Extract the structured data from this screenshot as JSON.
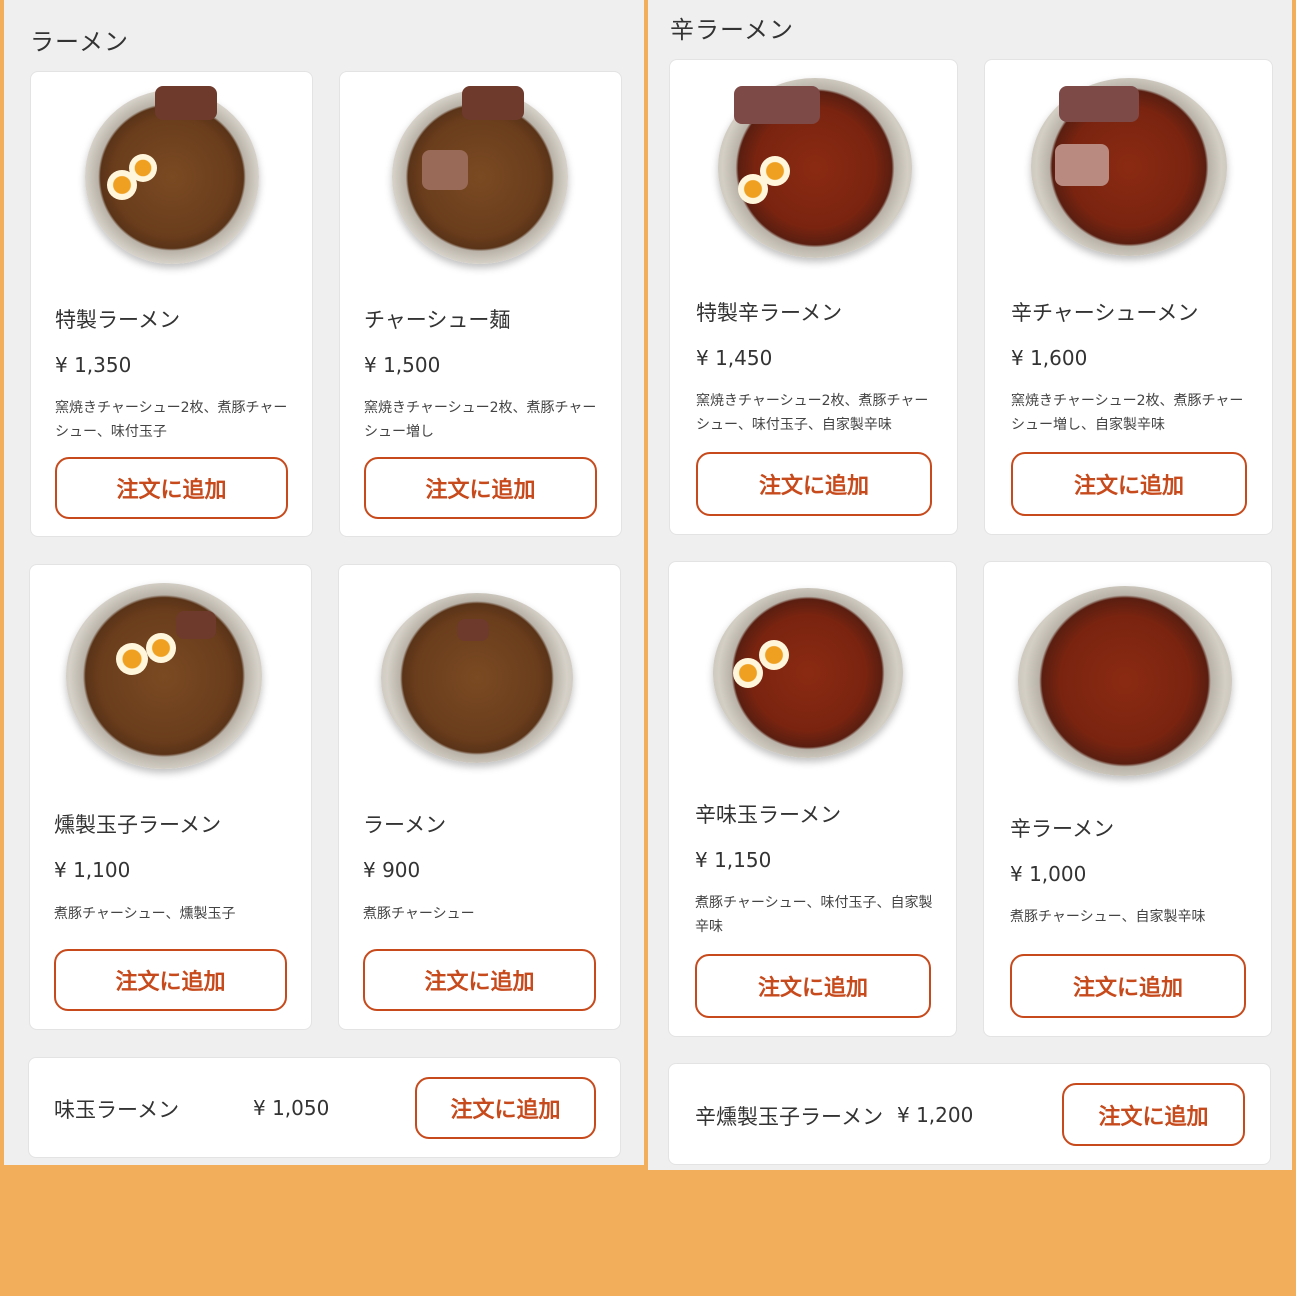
{
  "left": {
    "title": "ラーメン",
    "items": [
      {
        "name": "特製ラーメン",
        "price": "¥ 1,350",
        "desc": "窯焼きチャーシュー2枚、煮豚チャーシュー、味付玉子",
        "button": "注文に追加"
      },
      {
        "name": "チャーシュー麺",
        "price": "¥ 1,500",
        "desc": "窯焼きチャーシュー2枚、煮豚チャーシュー増し",
        "button": "注文に追加"
      },
      {
        "name": "燻製玉子ラーメン",
        "price": "¥ 1,100",
        "desc": "煮豚チャーシュー、燻製玉子",
        "button": "注文に追加"
      },
      {
        "name": "ラーメン",
        "price": "¥ 900",
        "desc": "煮豚チャーシュー",
        "button": "注文に追加"
      }
    ],
    "compact": {
      "name": "味玉ラーメン",
      "price": "¥ 1,050",
      "button": "注文に追加"
    }
  },
  "right": {
    "title": "辛ラーメン",
    "items": [
      {
        "name": "特製辛ラーメン",
        "price": "¥ 1,450",
        "desc": "窯焼きチャーシュー2枚、煮豚チャーシュー、味付玉子、自家製辛味",
        "button": "注文に追加"
      },
      {
        "name": "辛チャーシューメン",
        "price": "¥ 1,600",
        "desc": "窯焼きチャーシュー2枚、煮豚チャーシュー増し、自家製辛味",
        "button": "注文に追加"
      },
      {
        "name": "辛味玉ラーメン",
        "price": "¥ 1,150",
        "desc": "煮豚チャーシュー、味付玉子、自家製辛味",
        "button": "注文に追加"
      },
      {
        "name": "辛ラーメン",
        "price": "¥ 1,000",
        "desc": "煮豚チャーシュー、自家製辛味",
        "button": "注文に追加"
      }
    ],
    "compact": {
      "name": "辛燻製玉子ラーメン",
      "price": "¥ 1,200",
      "button": "注文に追加"
    }
  },
  "colors": {
    "accent": "#c74a1c",
    "background": "#f2ae5a",
    "panel": "#efefef"
  }
}
